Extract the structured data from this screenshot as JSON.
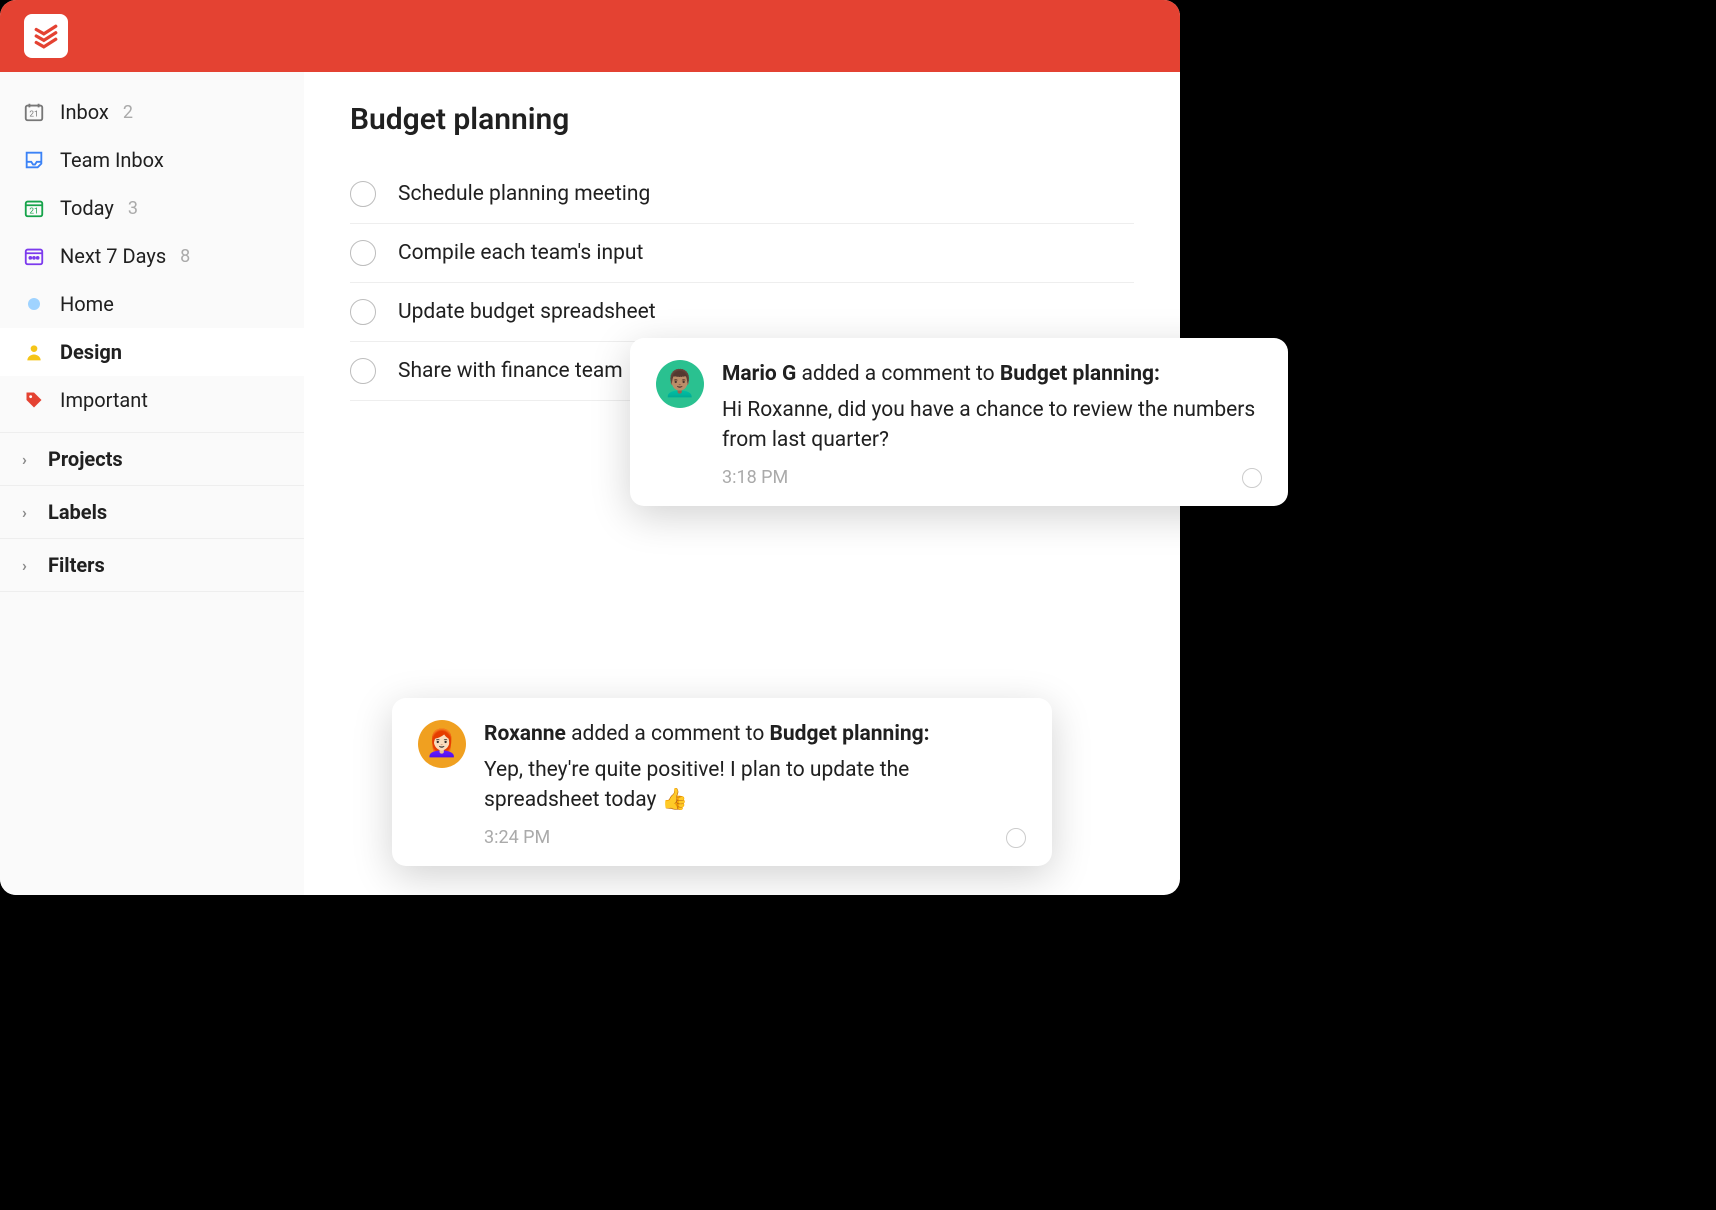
{
  "sidebar": {
    "inbox": {
      "label": "Inbox",
      "count": "2"
    },
    "team_inbox": {
      "label": "Team Inbox"
    },
    "today": {
      "label": "Today",
      "count": "3"
    },
    "next7": {
      "label": "Next 7 Days",
      "count": "8"
    },
    "home": {
      "label": "Home"
    },
    "design": {
      "label": "Design"
    },
    "important": {
      "label": "Important"
    },
    "sections": {
      "projects": "Projects",
      "labels": "Labels",
      "filters": "Filters"
    }
  },
  "main": {
    "title": "Budget planning",
    "tasks": [
      {
        "title": "Schedule planning meeting"
      },
      {
        "title": "Compile each team's input"
      },
      {
        "title": "Update budget spreadsheet"
      },
      {
        "title": "Share with finance team"
      }
    ]
  },
  "notifications": [
    {
      "author": "Mario G",
      "action": " added a comment to ",
      "target": "Budget planning:",
      "body": "Hi Roxanne, did you have a chance to review the numbers from last quarter?",
      "time": "3:18 PM",
      "avatar_bg": "#2ac190",
      "avatar_emoji": "👨🏽‍🦱"
    },
    {
      "author": "Roxanne",
      "action": " added a comment to ",
      "target": "Budget planning:",
      "body": "Yep, they're quite positive! I plan to update the spreadsheet today 👍",
      "time": "3:24 PM",
      "avatar_bg": "#f0a020",
      "avatar_emoji": "👩🏻‍🦰"
    }
  ]
}
